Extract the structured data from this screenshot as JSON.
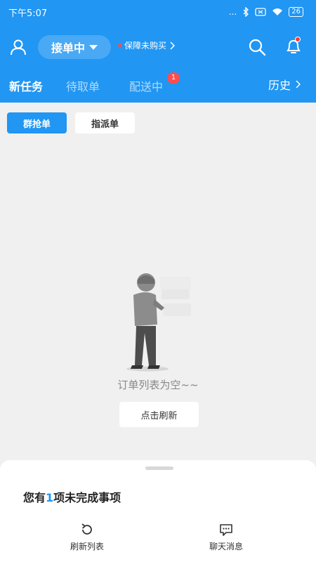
{
  "status_bar": {
    "time": "下午5:07",
    "indicators": "...",
    "battery": "26",
    "icons": [
      "bluetooth-icon",
      "sim-icon",
      "wifi-icon",
      "battery-icon"
    ]
  },
  "header": {
    "status_label": "接单中",
    "warranty_text": "保障未购买",
    "icons": [
      "user-icon",
      "search-icon",
      "bell-icon"
    ]
  },
  "tabs": {
    "items": [
      {
        "label": "新任务",
        "active": true
      },
      {
        "label": "待取单",
        "active": false
      },
      {
        "label": "配送中",
        "active": false,
        "badge": "1"
      }
    ],
    "history_label": "历史"
  },
  "filters": {
    "group_grab": "群抢单",
    "assigned": "指派单"
  },
  "empty_state": {
    "message": "订单列表为空~~",
    "refresh_label": "点击刷新"
  },
  "bottom_sheet": {
    "pending_prefix": "您有",
    "pending_count": "1",
    "pending_suffix": "项未完成事项",
    "refresh_list_label": "刷新列表",
    "chat_label": "聊天消息"
  },
  "colors": {
    "primary": "#2196f3",
    "badge": "#ff4d4f"
  }
}
